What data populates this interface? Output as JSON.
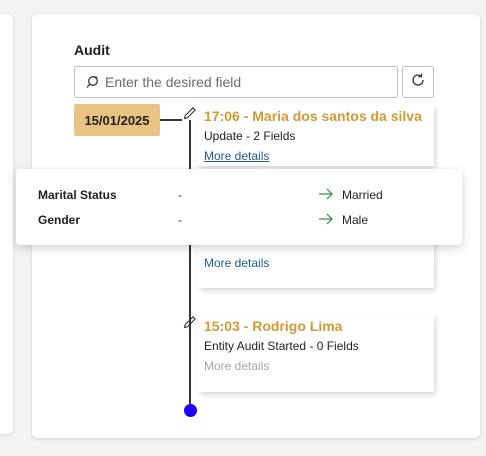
{
  "audit": {
    "title": "Audit",
    "search_placeholder": "Enter the desired field",
    "date": "15/01/2025"
  },
  "entries": [
    {
      "title": "17:06 - Maria dos santos da silva",
      "subtitle": "Update - 2 Fields",
      "link": "More details"
    },
    {
      "title": "",
      "subtitle": "",
      "link": "More details"
    },
    {
      "title": "15:03 - Rodrigo Lima",
      "subtitle": "Entity Audit Started - 0 Fields",
      "link": "More details"
    }
  ],
  "popover": {
    "rows": [
      {
        "field": "Marital Status",
        "old": "-",
        "new": "Married"
      },
      {
        "field": "Gender",
        "old": "-",
        "new": "Male"
      }
    ]
  },
  "colors": {
    "accent": "#d09a35",
    "date_badge": "#e8c381",
    "link": "#1f5a8f",
    "arrow": "#2e8b3e",
    "timeline_dot": "#1a00ff"
  },
  "icons": [
    "search-icon",
    "refresh-icon",
    "pencil-icon",
    "arrow-right-icon"
  ]
}
